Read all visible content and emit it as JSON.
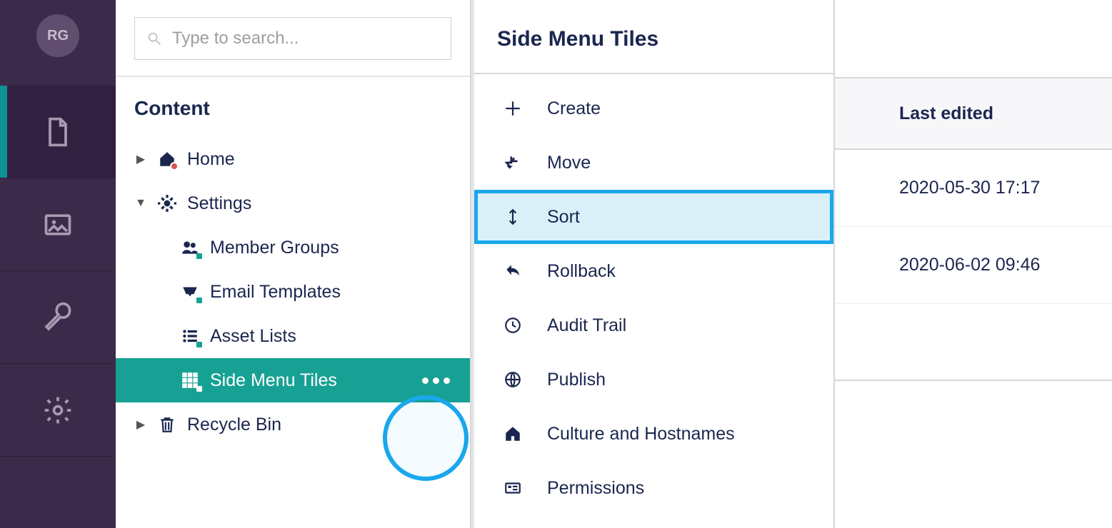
{
  "avatar": {
    "initials": "RG"
  },
  "search": {
    "placeholder": "Type to search..."
  },
  "section_title": "Content",
  "tree": {
    "home": {
      "label": "Home"
    },
    "settings": {
      "label": "Settings"
    },
    "member_groups": {
      "label": "Member Groups"
    },
    "email_templates": {
      "label": "Email Templates"
    },
    "asset_lists": {
      "label": "Asset Lists"
    },
    "side_menu_tiles": {
      "label": "Side Menu Tiles"
    },
    "recycle_bin": {
      "label": "Recycle Bin"
    }
  },
  "context_menu": {
    "title": "Side Menu Tiles",
    "items": {
      "create": {
        "label": "Create"
      },
      "move": {
        "label": "Move"
      },
      "sort": {
        "label": "Sort"
      },
      "rollback": {
        "label": "Rollback"
      },
      "audit_trail": {
        "label": "Audit Trail"
      },
      "publish": {
        "label": "Publish"
      },
      "culture": {
        "label": "Culture and Hostnames"
      },
      "permissions": {
        "label": "Permissions"
      }
    }
  },
  "table": {
    "header_last_edited": "Last edited",
    "rows": [
      {
        "last_edited": "2020-05-30 17:17"
      },
      {
        "last_edited": "2020-06-02 09:46"
      }
    ]
  }
}
